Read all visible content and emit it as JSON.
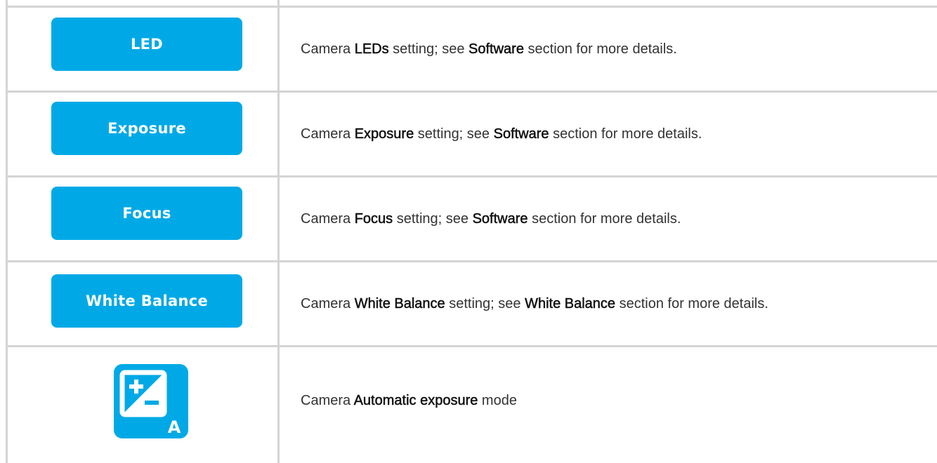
{
  "rows": [
    {
      "button_label": "LED",
      "description": {
        "prefix": "Camera ",
        "term": "LEDs",
        "middle": " setting; see ",
        "ref": "Software",
        "suffix": " section for more details."
      }
    },
    {
      "button_label": "Exposure",
      "description": {
        "prefix": "Camera ",
        "term": "Exposure",
        "middle": " setting; see ",
        "ref": "Software",
        "suffix": " section for more details."
      }
    },
    {
      "button_label": "Focus",
      "description": {
        "prefix": "Camera ",
        "term": "Focus",
        "middle": " setting; see ",
        "ref": "Software",
        "suffix": " section for more details."
      }
    },
    {
      "button_label": "White Balance",
      "description": {
        "prefix": "Camera ",
        "term": "White Balance",
        "middle": " setting; see ",
        "ref": "White Balance",
        "suffix": " section for more details."
      }
    },
    {
      "icon": "auto-exposure-icon",
      "icon_letter": "A",
      "description": {
        "prefix": "Camera ",
        "term": "Automatic exposure",
        "suffix": " mode"
      }
    }
  ],
  "colors": {
    "button": "#00a9e6",
    "border": "#d4d4d4",
    "text": "#333333"
  }
}
